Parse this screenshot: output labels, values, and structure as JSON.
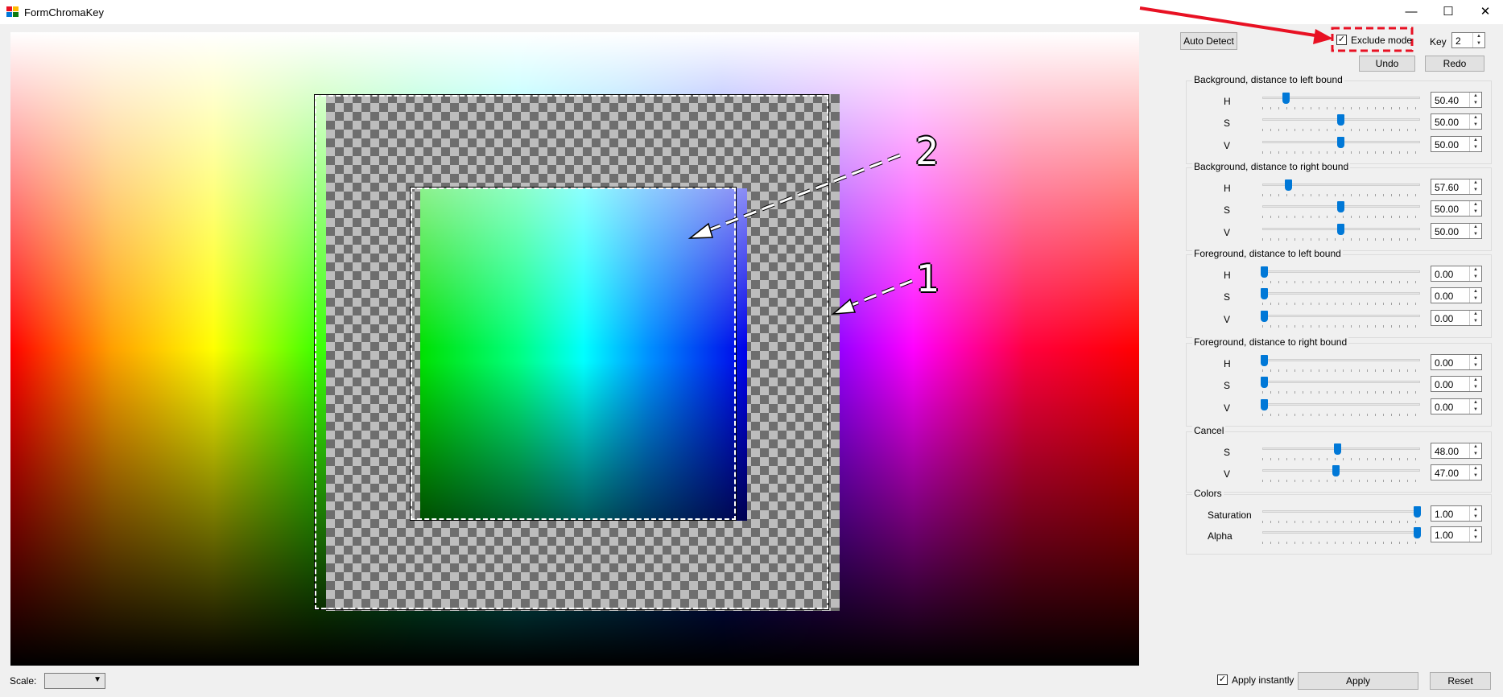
{
  "window": {
    "title": "FormChromaKey",
    "minimize": "—",
    "maximize": "☐",
    "close": "✕"
  },
  "toolbar": {
    "auto_detect": "Auto Detect",
    "exclude_mode": "Exclude mode",
    "exclude_mode_checked": true,
    "key_label": "Key",
    "key_value": "2",
    "undo": "Undo",
    "redo": "Redo"
  },
  "annotations": {
    "label_1": "1",
    "label_2": "2",
    "highlight_color": "#e81123"
  },
  "groups": [
    {
      "title": "Background, distance to left bound",
      "rows": [
        {
          "label": "H",
          "value": "50.40",
          "level": 0.14
        },
        {
          "label": "S",
          "value": "50.00",
          "level": 0.5
        },
        {
          "label": "V",
          "value": "50.00",
          "level": 0.5
        }
      ]
    },
    {
      "title": "Background, distance to right bound",
      "rows": [
        {
          "label": "H",
          "value": "57.60",
          "level": 0.16
        },
        {
          "label": "S",
          "value": "50.00",
          "level": 0.5
        },
        {
          "label": "V",
          "value": "50.00",
          "level": 0.5
        }
      ]
    },
    {
      "title": "Foreground, distance to left bound",
      "rows": [
        {
          "label": "H",
          "value": "0.00",
          "level": 0.0
        },
        {
          "label": "S",
          "value": "0.00",
          "level": 0.0
        },
        {
          "label": "V",
          "value": "0.00",
          "level": 0.0
        }
      ]
    },
    {
      "title": "Foreground, distance to right bound",
      "rows": [
        {
          "label": "H",
          "value": "0.00",
          "level": 0.0
        },
        {
          "label": "S",
          "value": "0.00",
          "level": 0.0
        },
        {
          "label": "V",
          "value": "0.00",
          "level": 0.0
        }
      ]
    },
    {
      "title": "Cancel",
      "rows": [
        {
          "label": "S",
          "value": "48.00",
          "level": 0.48
        },
        {
          "label": "V",
          "value": "47.00",
          "level": 0.47
        }
      ]
    },
    {
      "title": "Colors",
      "rows": [
        {
          "label": "Saturation",
          "value": "1.00",
          "level": 1.0
        },
        {
          "label": "Alpha",
          "value": "1.00",
          "level": 1.0
        }
      ]
    }
  ],
  "footer": {
    "scale_label": "Scale:",
    "scale_value": "",
    "apply_instantly": "Apply instantly",
    "apply_instantly_checked": true,
    "apply": "Apply",
    "reset": "Reset"
  }
}
